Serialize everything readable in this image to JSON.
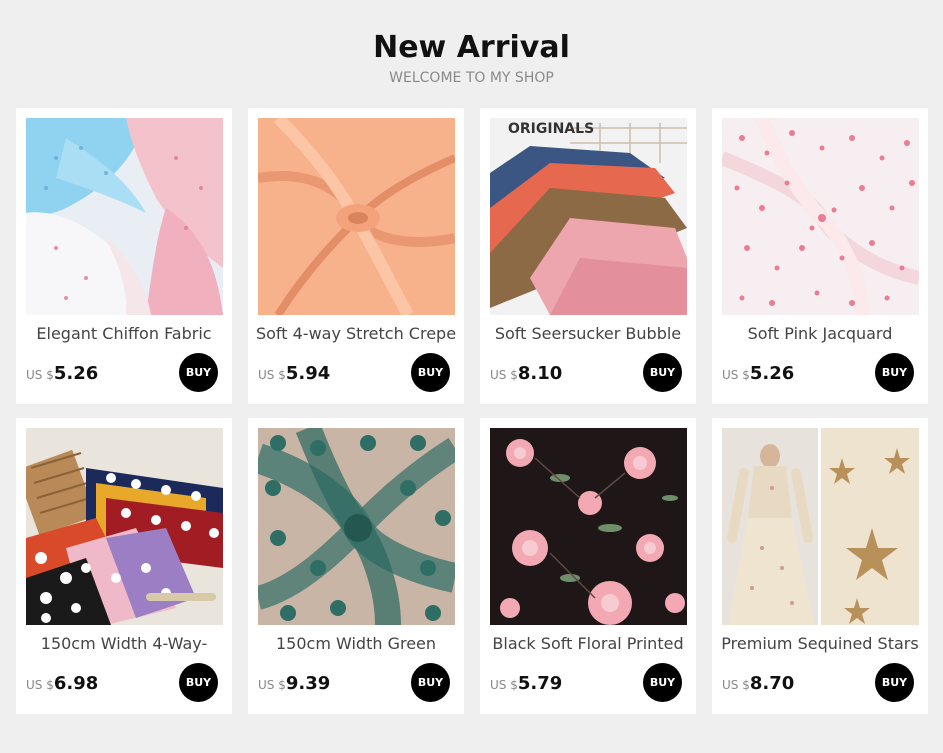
{
  "header": {
    "title": "New Arrival",
    "subtitle": "WELCOME TO MY SHOP"
  },
  "products": [
    {
      "name": "Elegant Chiffon Fabric",
      "currency": "US $",
      "price": "5.26",
      "buy_label": "BUY",
      "image": "light blue and pink floral chiffon fabric"
    },
    {
      "name": "Soft 4-way Stretch Crepe",
      "currency": "US $",
      "price": "5.94",
      "buy_label": "BUY",
      "image": "peach swirled crepe fabric"
    },
    {
      "name": "Soft Seersucker Bubble",
      "currency": "US $",
      "price": "8.10",
      "buy_label": "BUY",
      "image": "stacked fabrics in navy, coral, brown, pink",
      "image_text": "ORIGINALS"
    },
    {
      "name": "Soft Pink Jacquard",
      "currency": "US $",
      "price": "5.26",
      "buy_label": "BUY",
      "image": "pink speckled jacquard fabric swirl"
    },
    {
      "name": "150cm Width 4-Way-",
      "currency": "US $",
      "price": "6.98",
      "buy_label": "BUY",
      "image": "colorful polka dot fabrics"
    },
    {
      "name": "150cm Width Green",
      "currency": "US $",
      "price": "9.39",
      "buy_label": "BUY",
      "image": "green floral lace mesh swirl"
    },
    {
      "name": "Black Soft Floral Printed",
      "currency": "US $",
      "price": "5.79",
      "buy_label": "BUY",
      "image": "black fabric with pink flowers"
    },
    {
      "name": "Premium Sequined Stars",
      "currency": "US $",
      "price": "8.70",
      "buy_label": "BUY",
      "image": "cream dress and sequined starfish fabric"
    }
  ]
}
